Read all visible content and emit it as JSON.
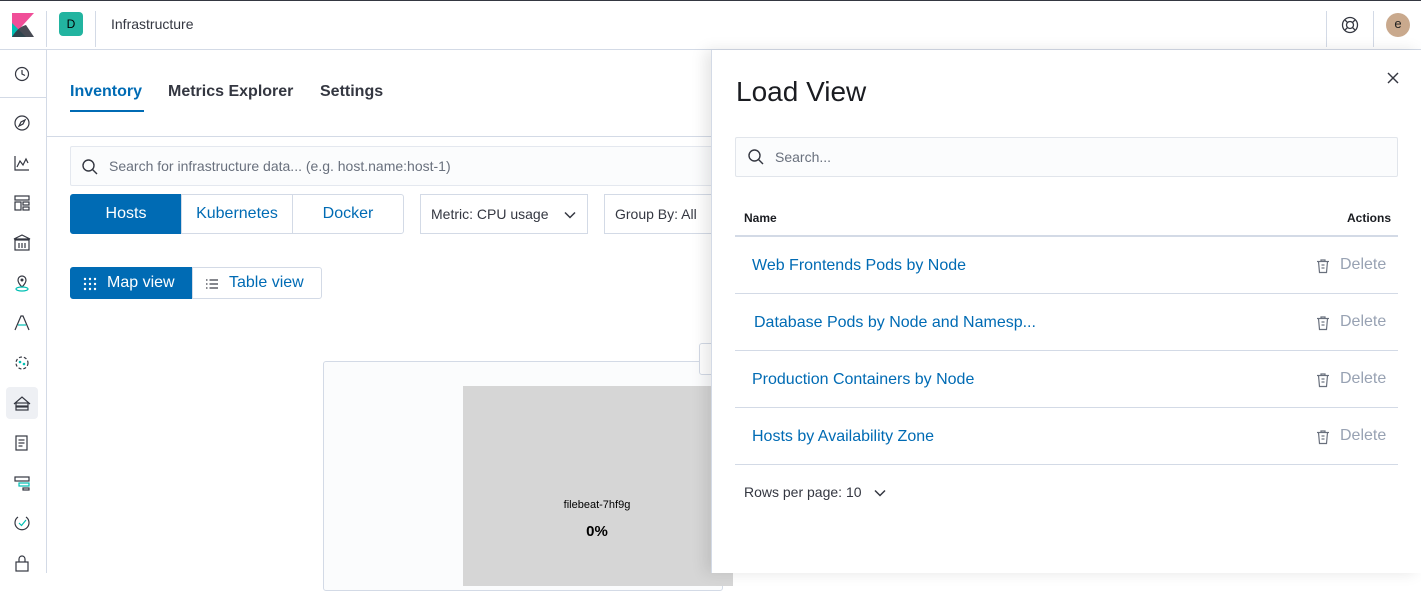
{
  "header": {
    "space_initial": "D",
    "breadcrumb": "Infrastructure",
    "user_initial": "e",
    "icons": [
      "kibana-logo-icon",
      "help-icon"
    ]
  },
  "sidenav": {
    "icons": [
      "recently-viewed-icon",
      "discover-icon",
      "visualize-icon",
      "dashboard-icon",
      "canvas-icon",
      "maps-icon",
      "machine-learning-icon",
      "metrics-icon",
      "infrastructure-icon",
      "logs-icon",
      "apm-icon",
      "uptime-icon",
      "security-icon"
    ],
    "active": "infrastructure-icon"
  },
  "tabs": [
    {
      "label": "Inventory",
      "active": true
    },
    {
      "label": "Metrics Explorer",
      "active": false
    },
    {
      "label": "Settings",
      "active": false
    }
  ],
  "search": {
    "placeholder": "Search for infrastructure data... (e.g. host.name:host-1)"
  },
  "node_types": [
    {
      "label": "Hosts",
      "selected": true
    },
    {
      "label": "Kubernetes",
      "selected": false
    },
    {
      "label": "Docker",
      "selected": false
    }
  ],
  "metric_select": "Metric: CPU usage",
  "group_by": "Group By: All",
  "view_toggle": {
    "map": "Map view",
    "table": "Table view",
    "selected": "map"
  },
  "map": {
    "node_name": "filebeat-7hf9g",
    "node_value": "0%"
  },
  "flyout": {
    "title": "Load View",
    "search_placeholder": "Search...",
    "columns": {
      "name": "Name",
      "actions": "Actions"
    },
    "rows": [
      {
        "name": "Web Frontends Pods by Node",
        "action": "Delete"
      },
      {
        "name": "Database Pods by Node and Namesp...",
        "action": "Delete"
      },
      {
        "name": "Production Containers by Node",
        "action": "Delete"
      },
      {
        "name": "Hosts by Availability Zone",
        "action": "Delete"
      }
    ],
    "rows_per_page": "Rows per page: 10"
  },
  "colors": {
    "accent": "#006bb4",
    "space_badge": "#22b4a0",
    "node_fill": "#d6d6d6"
  }
}
